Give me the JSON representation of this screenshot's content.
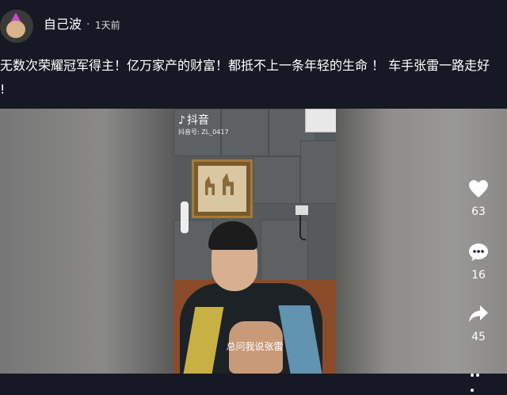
{
  "post": {
    "author": "自己波",
    "separator": "·",
    "time": "1天前",
    "caption_line1": "无数次荣耀冠军得主！亿万家产的财富！都抵不上一条年轻的生命 ！ 车手张雷一路走好",
    "caption_line2": "!"
  },
  "video": {
    "watermark_app": "抖音",
    "watermark_id": "抖音号: ZL_0417",
    "subtitle": "总问我说张雷"
  },
  "actions": {
    "likes": "63",
    "comments": "16",
    "shares": "45"
  }
}
